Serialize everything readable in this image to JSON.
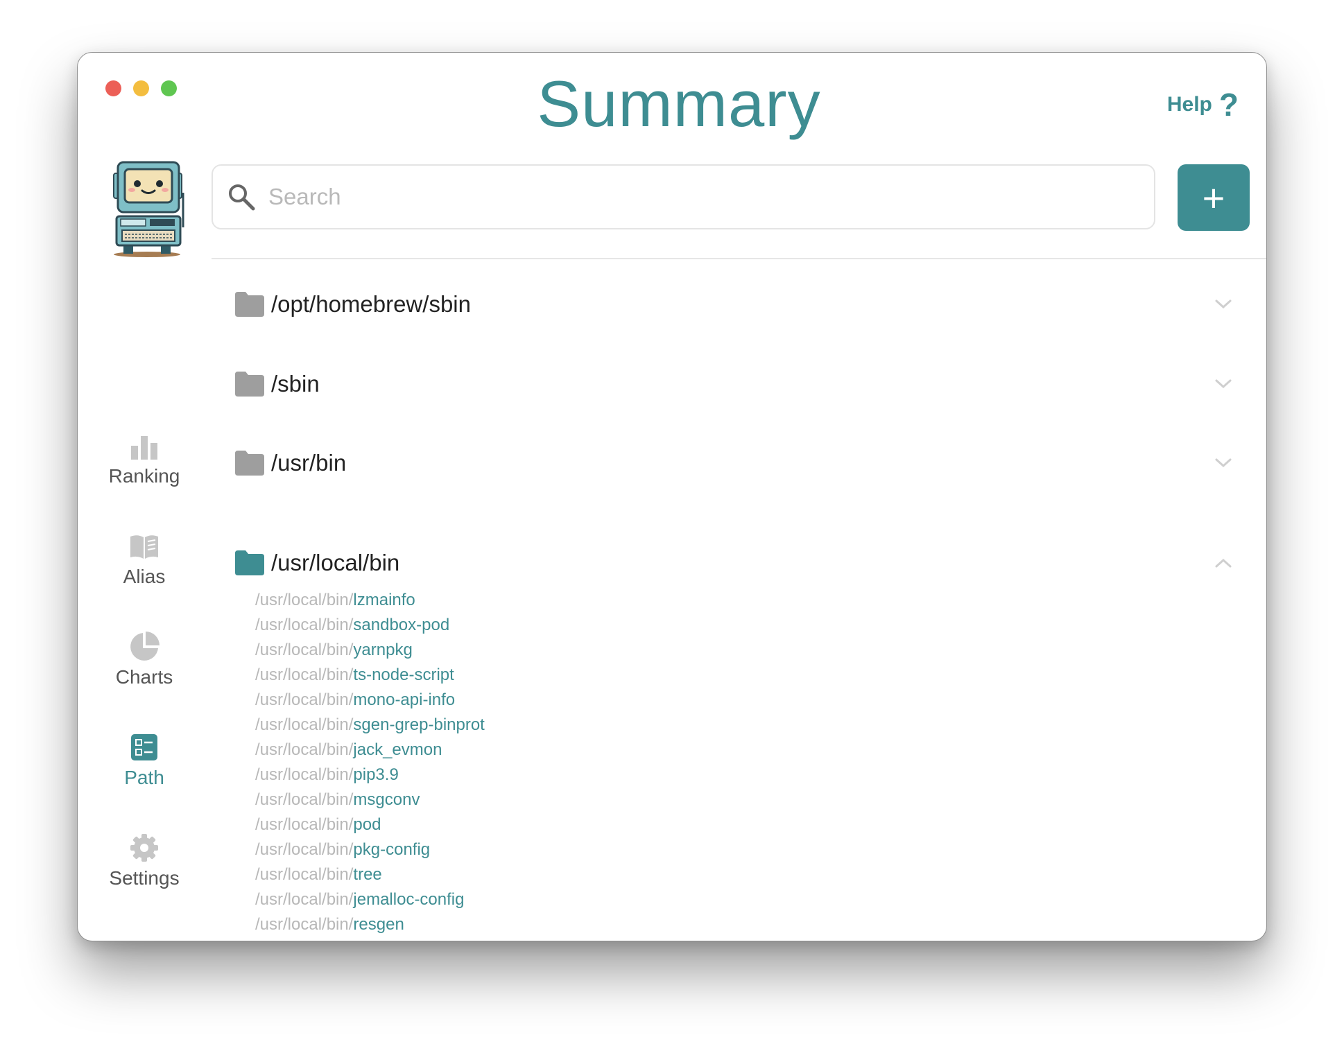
{
  "window": {
    "title": "Summary",
    "help_label": "Help",
    "help_icon": "?"
  },
  "colors": {
    "accent": "#3e8d92",
    "folder_gray": "#9e9e9e",
    "traffic_red": "#ec5f57",
    "traffic_yellow": "#f3bd3f",
    "traffic_green": "#5fc651"
  },
  "search": {
    "placeholder": "Search",
    "value": ""
  },
  "add_button": {
    "label": "+"
  },
  "sidebar": {
    "items": [
      {
        "label": "Ranking",
        "icon": "bar-chart-icon",
        "active": false
      },
      {
        "label": "Alias",
        "icon": "book-icon",
        "active": false
      },
      {
        "label": "Charts",
        "icon": "pie-chart-icon",
        "active": false
      },
      {
        "label": "Path",
        "icon": "path-list-icon",
        "active": true
      },
      {
        "label": "Settings",
        "icon": "gear-icon",
        "active": false
      }
    ]
  },
  "folders": [
    {
      "path": "/opt/homebrew/sbin",
      "expanded": false
    },
    {
      "path": "/sbin",
      "expanded": false
    },
    {
      "path": "/usr/bin",
      "expanded": false
    },
    {
      "path": "/usr/local/bin",
      "expanded": true
    }
  ],
  "expanded_list": {
    "prefix": "/usr/local/bin/",
    "items": [
      "lzmainfo",
      "sandbox-pod",
      "yarnpkg",
      "ts-node-script",
      "mono-api-info",
      "sgen-grep-binprot",
      "jack_evmon",
      "pip3.9",
      "msgconv",
      "pod",
      "pkg-config",
      "tree",
      "jemalloc-config",
      "resgen"
    ]
  }
}
